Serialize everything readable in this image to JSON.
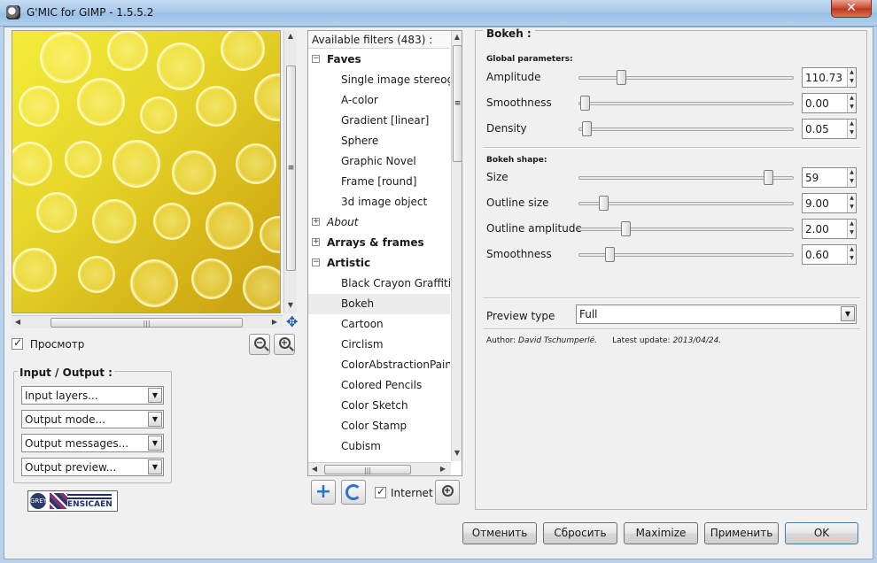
{
  "window": {
    "title": "G'MIC for GIMP - 1.5.5.2",
    "close_glyph": "✕"
  },
  "preview": {
    "checkbox_label": "Просмотр",
    "zoom_out_glyph": "−",
    "zoom_in_glyph": "+",
    "hscroll_grip": "|||",
    "vscroll_grip": "≡",
    "move_glyph": "✥"
  },
  "io": {
    "title": "Input / Output :",
    "combos": [
      "Input layers...",
      "Output mode...",
      "Output messages...",
      "Output preview..."
    ]
  },
  "logo": {
    "circle_text": "GREYC",
    "text": "ENSICAEN"
  },
  "filters": {
    "header": "Available filters (483) :",
    "rows": [
      {
        "type": "cat",
        "label": "Faves",
        "exp": "−",
        "style": "bold"
      },
      {
        "type": "leaf",
        "label": "Single image stereogram"
      },
      {
        "type": "leaf",
        "label": "A-color"
      },
      {
        "type": "leaf",
        "label": "Gradient [linear]"
      },
      {
        "type": "leaf",
        "label": "Sphere"
      },
      {
        "type": "leaf",
        "label": "Graphic Novel"
      },
      {
        "type": "leaf",
        "label": "Frame [round]"
      },
      {
        "type": "leaf",
        "label": "3d image object"
      },
      {
        "type": "cat",
        "label": "About",
        "exp": "+",
        "style": "italic"
      },
      {
        "type": "cat",
        "label": "Arrays & frames",
        "exp": "+",
        "style": "bold"
      },
      {
        "type": "cat",
        "label": "Artistic",
        "exp": "−",
        "style": "bold"
      },
      {
        "type": "leaf",
        "label": "Black Crayon Graffiti"
      },
      {
        "type": "leaf",
        "label": "Bokeh",
        "selected": true
      },
      {
        "type": "leaf",
        "label": "Cartoon"
      },
      {
        "type": "leaf",
        "label": "Circlism"
      },
      {
        "type": "leaf",
        "label": "ColorAbstractionPaint"
      },
      {
        "type": "leaf",
        "label": "Colored Pencils"
      },
      {
        "type": "leaf",
        "label": "Color Sketch"
      },
      {
        "type": "leaf",
        "label": "Color Stamp"
      },
      {
        "type": "leaf",
        "label": "Cubism"
      }
    ],
    "internet_label": "Internet",
    "add_glyph": "+",
    "zoom_glyph": "+"
  },
  "params": {
    "title": "Bokeh :",
    "global_title": "Global parameters:",
    "shape_title": "Bokeh shape:",
    "rows": [
      {
        "label": "Amplitude",
        "value": "110.73",
        "pos": 0.18
      },
      {
        "label": "Smoothness",
        "value": "0.00",
        "pos": 0.0
      },
      {
        "label": "Density",
        "value": "0.05",
        "pos": 0.01
      },
      {
        "label": "Size",
        "value": "59",
        "pos": 0.9
      },
      {
        "label": "Outline size",
        "value": "9.00",
        "pos": 0.09
      },
      {
        "label": "Outline amplitude",
        "value": "2.00",
        "pos": 0.2
      },
      {
        "label": "Smoothness",
        "value": "0.60",
        "pos": 0.12
      }
    ],
    "preview_type_label": "Preview type",
    "preview_type_value": "Full",
    "author_prefix": "Author: ",
    "author_name": "David Tschumperlé.",
    "update_prefix": "Latest update: ",
    "update_date": "2013/04/24."
  },
  "buttons": {
    "cancel": "Отменить",
    "reset": "Сбросить",
    "maximize": "Maximize",
    "apply": "Применить",
    "ok": "OK"
  },
  "colors": {
    "accent": "#2f74c6",
    "preview_yellow": "#f4ec3a",
    "preview_gold": "#c79e12"
  }
}
